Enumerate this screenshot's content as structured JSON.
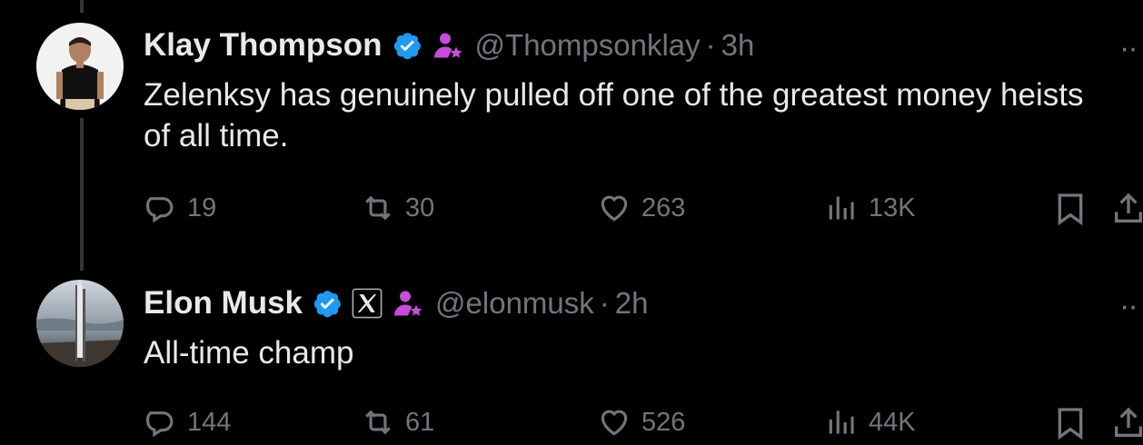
{
  "tweets": [
    {
      "name": "Klay Thompson",
      "handle": "@Thompsonklay",
      "separator": "·",
      "time": "3h",
      "text": "Zelenksy has genuinely pulled off one of the greatest money heists of all time.",
      "more": "··",
      "replies": "19",
      "reposts": "30",
      "likes": "263",
      "views": "13K"
    },
    {
      "name": "Elon Musk",
      "handle": "@elonmusk",
      "separator": "·",
      "time": "2h",
      "text": "All-time champ",
      "more": "··",
      "replies": "144",
      "reposts": "61",
      "likes": "526",
      "views": "44K"
    }
  ],
  "colors": {
    "background": "#000000",
    "verified": "#1d9bf0",
    "subscriber_badge": "#c94bdc",
    "muted": "#71767b",
    "text": "#e7e9ea"
  }
}
